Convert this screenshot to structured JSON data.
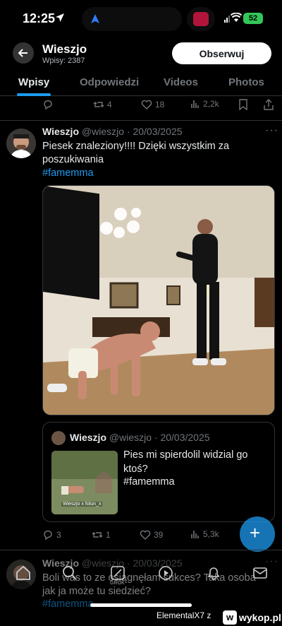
{
  "status_bar": {
    "time": "12:25",
    "battery": "52"
  },
  "header": {
    "name": "Wieszjo",
    "subtitle": "Wpisy: 2387",
    "follow_label": "Obserwuj"
  },
  "tabs": [
    {
      "label": "Wpisy",
      "active": true
    },
    {
      "label": "Odpowiedzi",
      "active": false
    },
    {
      "label": "Videos",
      "active": false
    },
    {
      "label": "Photos",
      "active": false
    }
  ],
  "prev_tweet_actions": {
    "retweets": "4",
    "likes": "18",
    "views": "2,2k"
  },
  "tweet": {
    "name": "Wieszjo",
    "handle": "@wieszjo",
    "date": "· 20/03/2025",
    "text_line1": "Piesek znaleziony!!!! Dzięki wszystkim za",
    "text_line2": "poszukiwania",
    "hashtag": "#famemma",
    "quote": {
      "name": "Wieszjo",
      "handle": "@wieszjo",
      "date": "· 20/03/2025",
      "text_line1": "Pies mi spierdolil widzial go",
      "text_line2": "ktoś?",
      "hashtag": "#famemma",
      "thumb_caption": "Wieszjo x folun_x"
    },
    "actions": {
      "replies": "3",
      "retweets": "1",
      "likes": "39",
      "views": "5,3k"
    }
  },
  "next_tweet": {
    "name": "Wieszjo",
    "handle": "@wieszjo",
    "date": "· 20/03/2025",
    "text_line1": "Boli was to ze osiągnęłam sukces? Taka osoba",
    "text_line2": "jak ja może tu siedzieć?",
    "hashtag": "#famemma"
  },
  "bottom_nav": {
    "grok_label": "GROK"
  },
  "footer": {
    "watermark": "ElementalX7  z",
    "site": "wykop.pl"
  },
  "colors": {
    "accent": "#1d9bf0",
    "background": "#000000",
    "muted": "#71767b"
  }
}
